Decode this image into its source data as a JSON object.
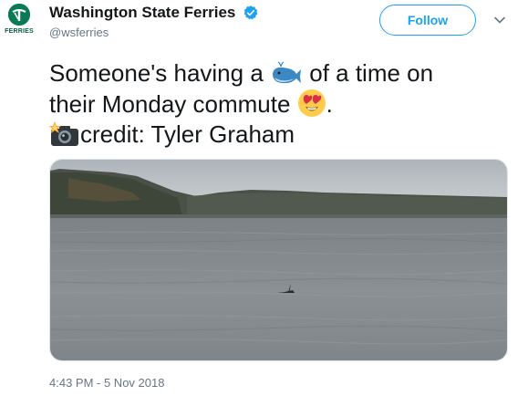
{
  "account": {
    "display_name": "Washington State Ferries",
    "handle": "@wsferries",
    "logo_text": "FERRIES",
    "verified": true
  },
  "actions": {
    "follow_label": "Follow"
  },
  "tweet": {
    "line1_pre": "Someone's having a ",
    "line1_post": " of a time on",
    "line2_pre": "their Monday commute ",
    "line2_post": ".",
    "line3": "credit: Tyler Graham",
    "emojis": [
      "whale-emoji",
      "heart-eyes-emoji",
      "camera-flash-emoji"
    ]
  },
  "meta": {
    "timestamp": "4:43 PM - 5 Nov 2018"
  },
  "colors": {
    "brand_green": "#0a7a55",
    "twitter_blue": "#1da1f2",
    "secondary_text": "#657786"
  }
}
